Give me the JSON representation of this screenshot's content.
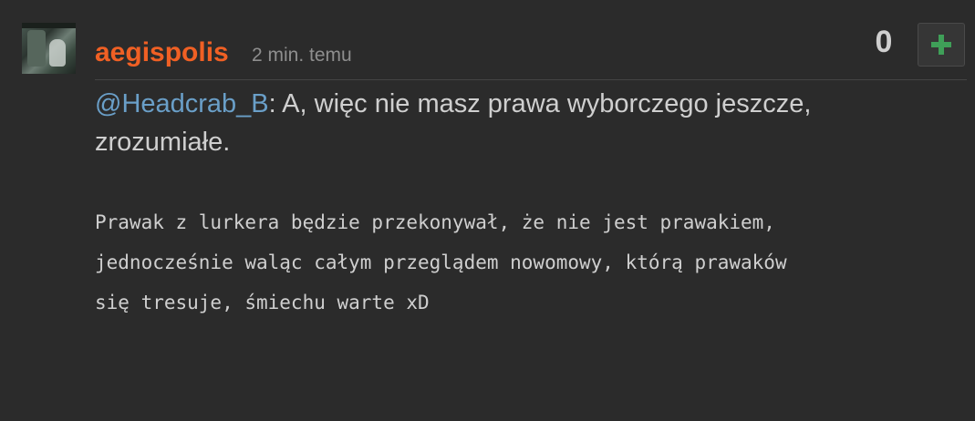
{
  "comment": {
    "username": "aegispolis",
    "timestamp": "2 min. temu",
    "score": "0",
    "upvote_icon": "plus-icon",
    "mention": "@Headcrab_B",
    "reply_text": ": A, więc nie masz prawa wyborczego jeszcze, zrozumiałe.",
    "quote_text": "Prawak z lurkera będzie przekonywał, że nie jest prawakiem,\njednocześnie waląc całym przeglądem nowomowy, którą prawaków\nsię tresuje, śmiechu warte xD"
  },
  "colors": {
    "username": "#f06024",
    "mention": "#6a9fc8",
    "upvote": "#3f9f58",
    "background": "#2b2b2b"
  }
}
